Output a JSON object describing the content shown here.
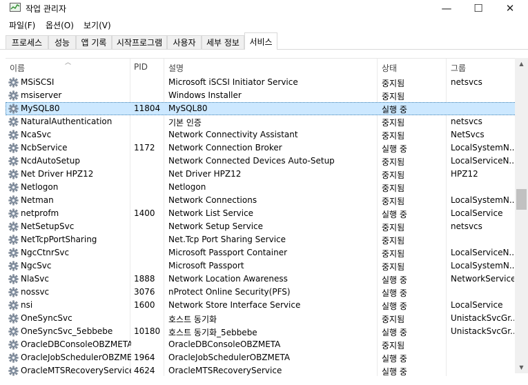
{
  "window": {
    "title": "작업 관리자",
    "minimize": "—",
    "maximize": "☐",
    "close": "✕"
  },
  "menu": [
    "파일(F)",
    "옵션(O)",
    "보기(V)"
  ],
  "tabs": [
    "프로세스",
    "성능",
    "앱 기록",
    "시작프로그램",
    "사용자",
    "세부 정보",
    "서비스"
  ],
  "active_tab": "서비스",
  "columns": {
    "name": "이름",
    "pid": "PID",
    "desc": "설명",
    "status": "상태",
    "group": "그룹"
  },
  "colors": {
    "selected_bg": "#cce8ff",
    "accent": "#3c7fb1"
  },
  "rows": [
    {
      "name": "MSiSCSI",
      "pid": "",
      "desc": "Microsoft iSCSI Initiator Service",
      "status": "중지됨",
      "group": "netsvcs"
    },
    {
      "name": "msiserver",
      "pid": "",
      "desc": "Windows Installer",
      "status": "중지됨",
      "group": ""
    },
    {
      "name": "MySQL80",
      "pid": "11804",
      "desc": "MySQL80",
      "status": "실행 중",
      "group": "",
      "selected": true
    },
    {
      "name": "NaturalAuthentication",
      "pid": "",
      "desc": "기본 인증",
      "status": "중지됨",
      "group": "netsvcs"
    },
    {
      "name": "NcaSvc",
      "pid": "",
      "desc": "Network Connectivity Assistant",
      "status": "중지됨",
      "group": "NetSvcs"
    },
    {
      "name": "NcbService",
      "pid": "1172",
      "desc": "Network Connection Broker",
      "status": "실행 중",
      "group": "LocalSystemN..."
    },
    {
      "name": "NcdAutoSetup",
      "pid": "",
      "desc": "Network Connected Devices Auto-Setup",
      "status": "중지됨",
      "group": "LocalServiceN..."
    },
    {
      "name": "Net Driver HPZ12",
      "pid": "",
      "desc": "Net Driver HPZ12",
      "status": "중지됨",
      "group": "HPZ12"
    },
    {
      "name": "Netlogon",
      "pid": "",
      "desc": "Netlogon",
      "status": "중지됨",
      "group": ""
    },
    {
      "name": "Netman",
      "pid": "",
      "desc": "Network Connections",
      "status": "중지됨",
      "group": "LocalSystemN..."
    },
    {
      "name": "netprofm",
      "pid": "1400",
      "desc": "Network List Service",
      "status": "실행 중",
      "group": "LocalService"
    },
    {
      "name": "NetSetupSvc",
      "pid": "",
      "desc": "Network Setup Service",
      "status": "중지됨",
      "group": "netsvcs"
    },
    {
      "name": "NetTcpPortSharing",
      "pid": "",
      "desc": "Net.Tcp Port Sharing Service",
      "status": "중지됨",
      "group": ""
    },
    {
      "name": "NgcCtnrSvc",
      "pid": "",
      "desc": "Microsoft Passport Container",
      "status": "중지됨",
      "group": "LocalServiceN..."
    },
    {
      "name": "NgcSvc",
      "pid": "",
      "desc": "Microsoft Passport",
      "status": "중지됨",
      "group": "LocalSystemN..."
    },
    {
      "name": "NlaSvc",
      "pid": "1888",
      "desc": "Network Location Awareness",
      "status": "실행 중",
      "group": "NetworkService"
    },
    {
      "name": "nossvc",
      "pid": "3076",
      "desc": "nProtect Online Security(PFS)",
      "status": "실행 중",
      "group": ""
    },
    {
      "name": "nsi",
      "pid": "1600",
      "desc": "Network Store Interface Service",
      "status": "실행 중",
      "group": "LocalService"
    },
    {
      "name": "OneSyncSvc",
      "pid": "",
      "desc": "호스트 동기화",
      "status": "중지됨",
      "group": "UnistackSvcGr..."
    },
    {
      "name": "OneSyncSvc_5ebbebe",
      "pid": "10180",
      "desc": "호스트 동기화_5ebbebe",
      "status": "실행 중",
      "group": "UnistackSvcGr..."
    },
    {
      "name": "OracleDBConsoleOBZMETA",
      "pid": "",
      "desc": "OracleDBConsoleOBZMETA",
      "status": "중지됨",
      "group": ""
    },
    {
      "name": "OracleJobSchedulerOBZME...",
      "pid": "1964",
      "desc": "OracleJobSchedulerOBZMETA",
      "status": "실행 중",
      "group": ""
    },
    {
      "name": "OracleMTSRecoveryService",
      "pid": "4624",
      "desc": "OracleMTSRecoveryService",
      "status": "실행 중",
      "group": ""
    }
  ]
}
